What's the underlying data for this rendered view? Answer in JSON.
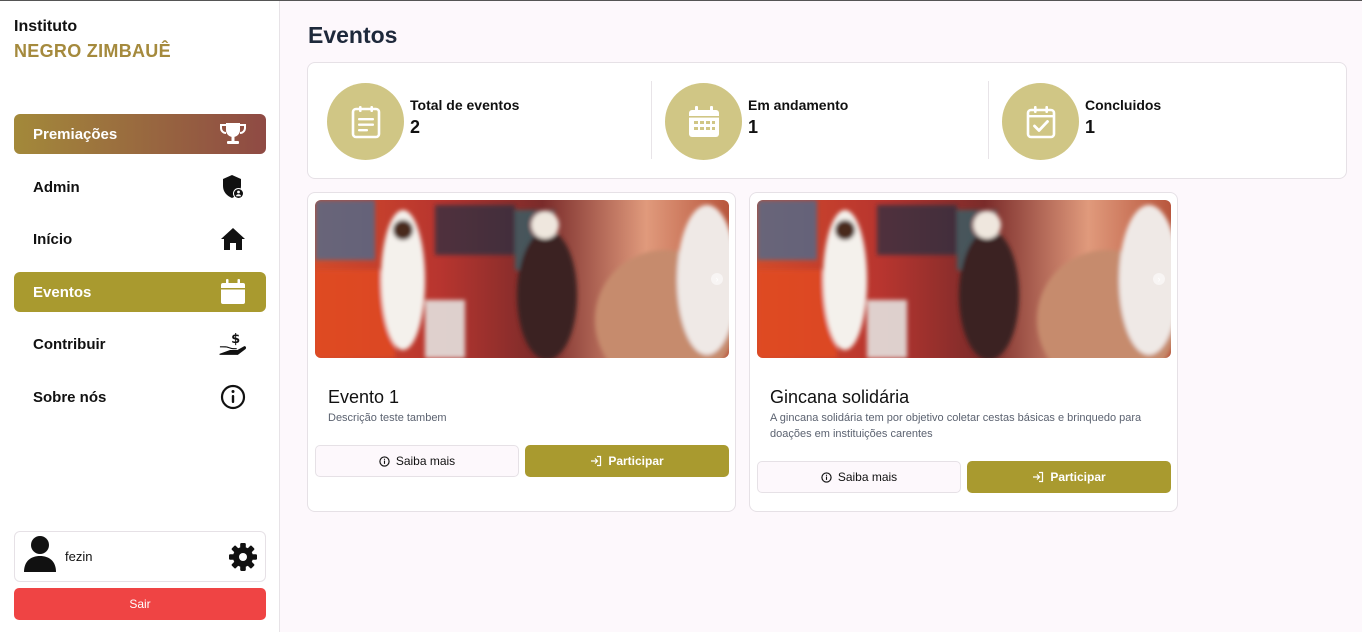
{
  "brand": {
    "line1": "Instituto",
    "line2": "NEGRO ZIMBAUÊ"
  },
  "sidebar": {
    "items": [
      {
        "label": "Premiações",
        "icon": "trophy-icon"
      },
      {
        "label": "Admin",
        "icon": "shield-user-icon"
      },
      {
        "label": "Início",
        "icon": "home-icon"
      },
      {
        "label": "Eventos",
        "icon": "calendar-icon"
      },
      {
        "label": "Contribuir",
        "icon": "donate-hand-icon"
      },
      {
        "label": "Sobre nós",
        "icon": "info-icon"
      }
    ],
    "user": {
      "name": "fezin"
    },
    "logout_label": "Sair"
  },
  "main": {
    "title": "Eventos",
    "stats": [
      {
        "label": "Total de eventos",
        "value": "2",
        "icon": "document-icon"
      },
      {
        "label": "Em andamento",
        "value": "1",
        "icon": "calendar-grid-icon"
      },
      {
        "label": "Concluidos",
        "value": "1",
        "icon": "calendar-check-icon"
      }
    ],
    "events": [
      {
        "title": "Evento 1",
        "description": "Descrição teste tambem",
        "more_label": "Saiba mais",
        "join_label": "Participar"
      },
      {
        "title": "Gincana solidária",
        "description": "A gincana solidária tem por objetivo coletar cestas básicas e brinquedo para doações em instituições carentes",
        "more_label": "Saiba mais",
        "join_label": "Participar"
      }
    ]
  },
  "colors": {
    "accent": "#a99a2f",
    "stat_circle": "#d0c685",
    "brand_gold": "#a58a3d",
    "danger": "#ef4444",
    "gradient_end": "#8f4a44"
  }
}
